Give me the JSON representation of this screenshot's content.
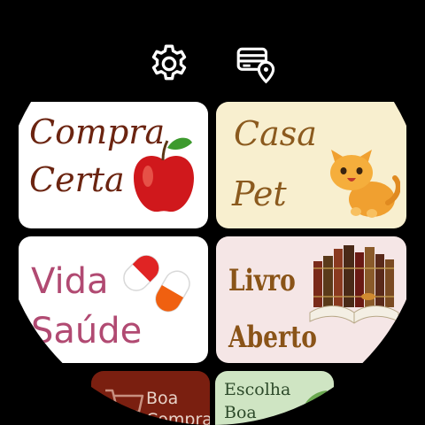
{
  "toolbar": {
    "settings_icon": "gear-icon",
    "stores_icon": "store-location-icon"
  },
  "cards": [
    {
      "id": "compra-certa",
      "line1": "Compra",
      "line2": "Certa",
      "image": "apple-icon",
      "bg": "#ffffff",
      "text_color": "#6b2410"
    },
    {
      "id": "casa-pet",
      "line1": "Casa",
      "line2": "Pet",
      "image": "cat-icon",
      "bg": "#f8efcf",
      "text_color": "#8b5a1e"
    },
    {
      "id": "vida-saude",
      "line1": "Vida",
      "line2": "Saúde",
      "image": "pill-capsules-icon",
      "bg": "#ffffff",
      "text_color": "#b14a72"
    },
    {
      "id": "livro-aberto",
      "line1": "Livro",
      "line2": "Aberto",
      "image": "books-icon",
      "bg": "#f5e6e6",
      "text_color": "#8a5418"
    },
    {
      "id": "boa-compra",
      "line1": "Boa",
      "line2": "Compra",
      "image": "shopping-cart-icon",
      "bg": "#7a1f10",
      "text_color": "#e8d2c8"
    },
    {
      "id": "escolha-boa",
      "line1": "Escolha",
      "line2": "Boa",
      "image": "leaf-icon",
      "bg": "#cfe5c3",
      "text_color": "#2d4a2a"
    }
  ]
}
